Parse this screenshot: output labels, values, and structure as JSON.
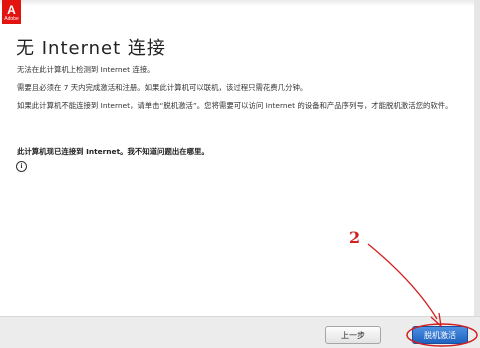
{
  "logo": {
    "glyph": "A",
    "text": "Adobe",
    "color": "#e3130f"
  },
  "heading": "无 Internet 连接",
  "paragraphs": {
    "p1": "无法在此计算机上检测到 Internet 连接。",
    "p2": "需要且必须在 7 天内完成激活和注册。如果此计算机可以联机，该过程只需花费几分钟。",
    "p3": "如果此计算机不能连接到 Internet，请单击“脱机激活”。您将需要可以访问 Internet 的设备和产品序列号，才能脱机激活您的软件。",
    "p4": "此计算机现已连接到 Internet。我不知道问题出在哪里。"
  },
  "info_icon": "i",
  "buttons": {
    "back": "上一步",
    "offline": "脱机激活"
  },
  "annotation": {
    "step_number": "2",
    "color": "#d21f1f"
  }
}
